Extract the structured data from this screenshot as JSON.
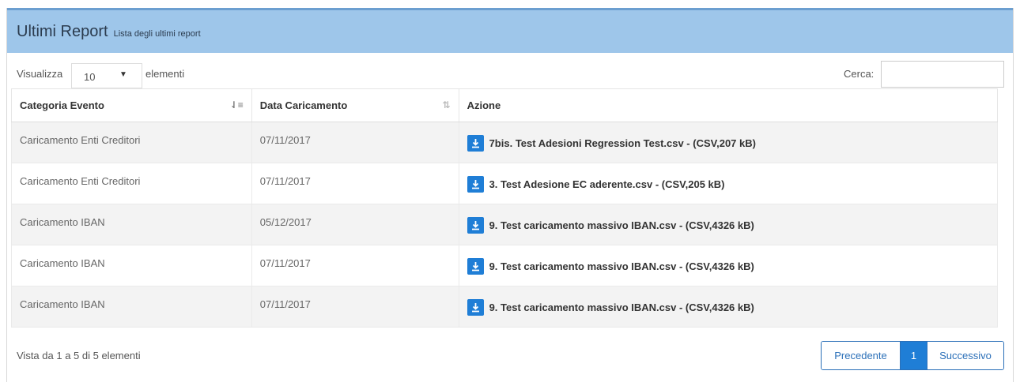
{
  "panel": {
    "title": "Ultimi Report",
    "subtitle": "Lista degli ultimi report"
  },
  "length": {
    "prefix": "Visualizza",
    "value": "10",
    "suffix": "elementi"
  },
  "search": {
    "label": "Cerca:",
    "value": ""
  },
  "table": {
    "columns": [
      "Categoria Evento",
      "Data Caricamento",
      "Azione"
    ],
    "rows": [
      {
        "category": "Caricamento Enti Creditori",
        "date": "07/11/2017",
        "file": "7bis. Test Adesioni Regression Test.csv - (CSV,207 kB)"
      },
      {
        "category": "Caricamento Enti Creditori",
        "date": "07/11/2017",
        "file": "3. Test Adesione EC aderente.csv - (CSV,205 kB)"
      },
      {
        "category": "Caricamento IBAN",
        "date": "05/12/2017",
        "file": "9. Test caricamento massivo IBAN.csv - (CSV,4326 kB)"
      },
      {
        "category": "Caricamento IBAN",
        "date": "07/11/2017",
        "file": "9. Test caricamento massivo IBAN.csv - (CSV,4326 kB)"
      },
      {
        "category": "Caricamento IBAN",
        "date": "07/11/2017",
        "file": "9. Test caricamento massivo IBAN.csv - (CSV,4326 kB)"
      }
    ]
  },
  "footer": {
    "info": "Vista da 1 a 5 di 5 elementi"
  },
  "pagination": {
    "prev": "Precedente",
    "current": "1",
    "next": "Successivo"
  },
  "colors": {
    "header_bg": "#9ec6ea",
    "accent": "#1f7ed6"
  },
  "icons": [
    "sort-active-icon",
    "sort-icon",
    "download-icon",
    "caret-down-icon"
  ]
}
